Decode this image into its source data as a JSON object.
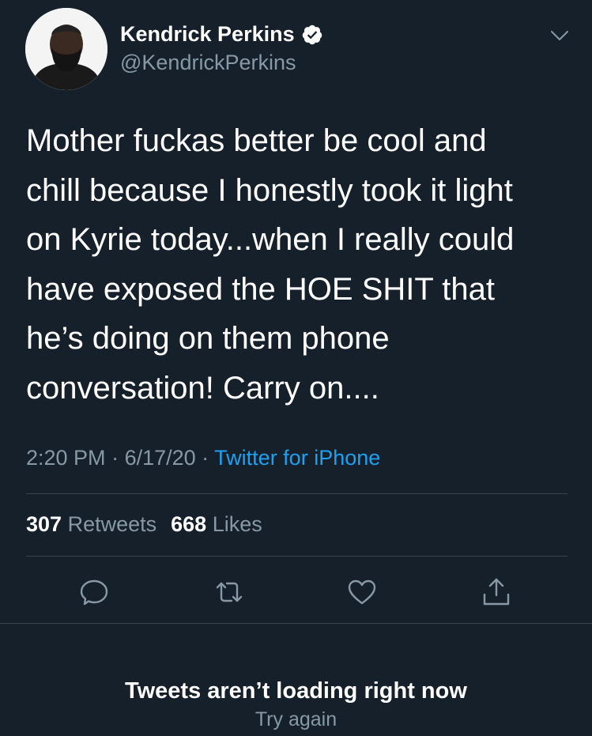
{
  "user": {
    "display_name": "Kendrick Perkins",
    "handle": "@KendrickPerkins",
    "verified_icon": "verified-badge-icon",
    "menu_icon": "chevron-down-icon"
  },
  "tweet": {
    "text": "Mother fuckas better be cool and\nchill because I honestly took it light\non Kyrie today...when I really could\nhave exposed the HOE SHIT that\nhe’s doing on them phone\nconversation! Carry on....",
    "time": "2:20 PM",
    "sep1": " · ",
    "date": "6/17/20",
    "sep2": " · ",
    "source": "Twitter for iPhone"
  },
  "stats": {
    "retweets_count": "307",
    "retweets_label": "Retweets",
    "likes_count": "668",
    "likes_label": "Likes"
  },
  "actions": [
    "reply-icon",
    "retweet-icon",
    "like-icon",
    "share-icon"
  ],
  "error": {
    "title": "Tweets aren’t loading right now",
    "retry": "Try again"
  },
  "colors": {
    "background": "#15202b",
    "secondary_text": "#8899a6",
    "accent": "#1da1f2",
    "divider": "#38444d"
  }
}
